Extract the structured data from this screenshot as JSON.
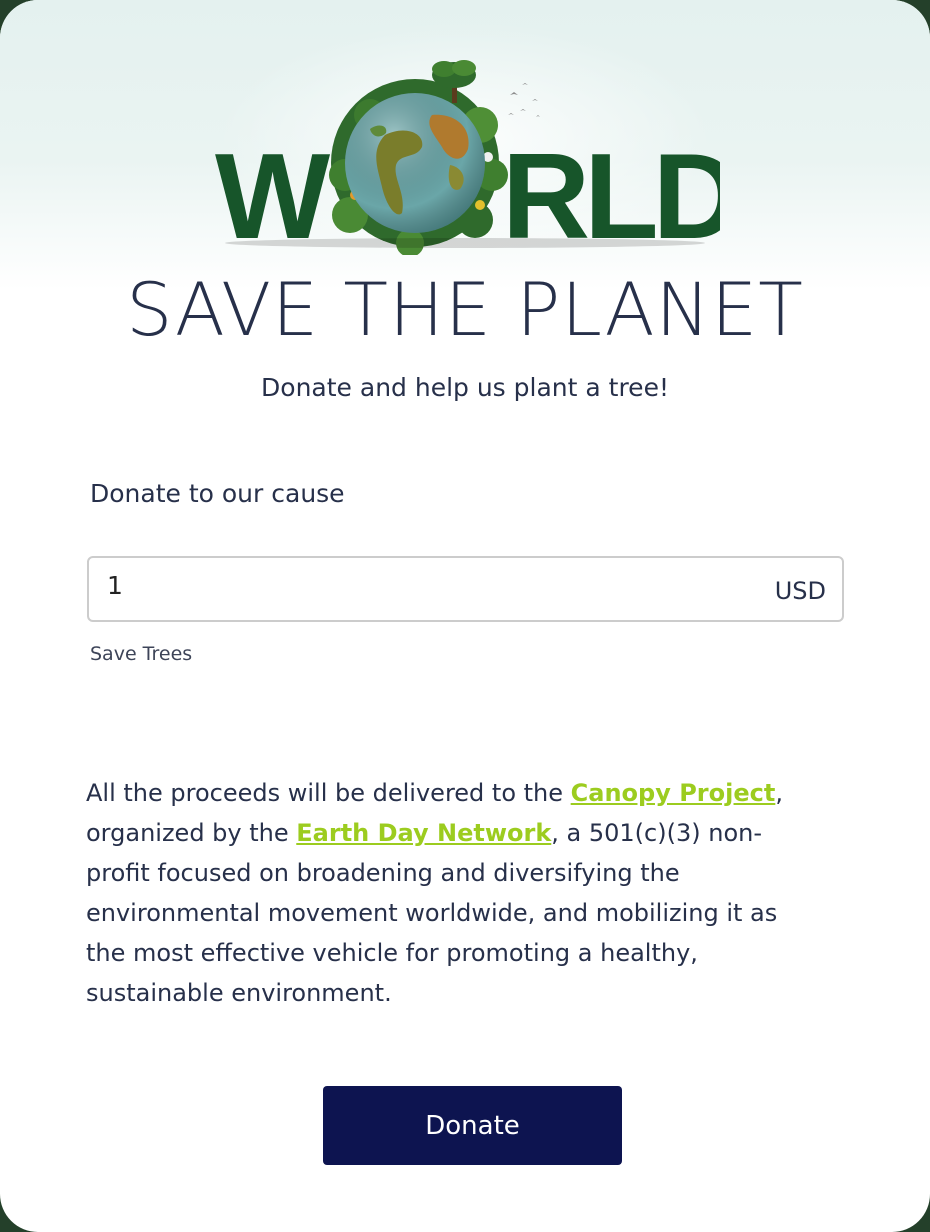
{
  "hero": {
    "logo_text": "WORLD",
    "title": "SAVE THE PLANET",
    "subtitle": "Donate and help us plant a tree!"
  },
  "form": {
    "label": "Donate to our cause",
    "amount_value": "1",
    "currency": "USD",
    "helper": "Save Trees"
  },
  "info": {
    "text_1": "All the proceeds will be delivered to the ",
    "link_1": "Canopy Project",
    "text_2": ", organized by the ",
    "link_2": "Earth Day Network",
    "text_3": ", a 501(c)(3) non-profit focused on broadening and diversifying the environmental movement worldwide, and mobilizing it as the most effective vehicle for promoting a healthy, sustainable environment."
  },
  "actions": {
    "donate_label": "Donate"
  },
  "colors": {
    "title": "#27304a",
    "link": "#9ccc1f",
    "button_bg": "#0d1450",
    "logo_green": "#17552a"
  }
}
